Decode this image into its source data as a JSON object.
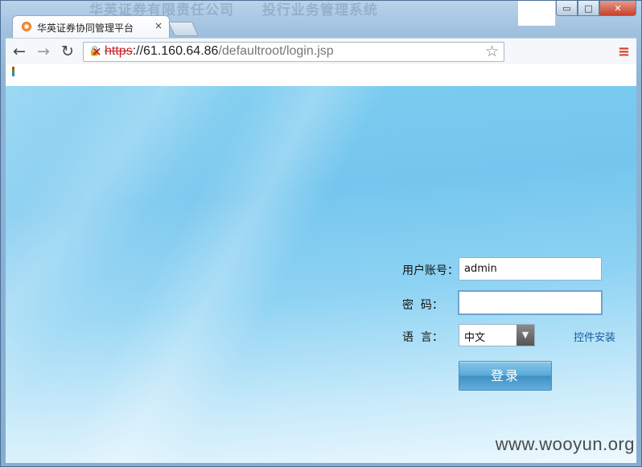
{
  "browser": {
    "tab_title": "华英证券协同管理平台",
    "tab_close": "×",
    "title_bar_faded_text": [
      "华英证券有限责任公司",
      "投行业务管理系统"
    ],
    "url": {
      "scheme": "https",
      "rest_host": "://61.160.64.86",
      "path": "/defaultroot/login.jsp"
    },
    "buttons": {
      "back": "←",
      "forward": "→",
      "reload": "↻",
      "star": "☆",
      "menu": "≡",
      "minimize": "▭",
      "maximize": "□",
      "close": "✕"
    }
  },
  "login_form": {
    "username_label": "用户账号：",
    "username_value": "admin",
    "password_label": "密  码：",
    "password_value": "",
    "language_label": "语  言：",
    "language_selected": "中文",
    "language_arrow": "▼",
    "install_link": "控件安装",
    "submit_label": "登录"
  },
  "watermark": "www.wooyun.org",
  "colors": {
    "page_gradient_top": "#74c6ee",
    "page_gradient_bottom": "#eef9fe",
    "login_button": "#5aa9d9",
    "link": "#1a5b9c",
    "insecure_scheme": "#c52222"
  },
  "icons": [
    "favicon-icon",
    "back-icon",
    "forward-icon",
    "reload-icon",
    "insecure-lock-icon",
    "star-icon",
    "chrome-menu-icon"
  ]
}
